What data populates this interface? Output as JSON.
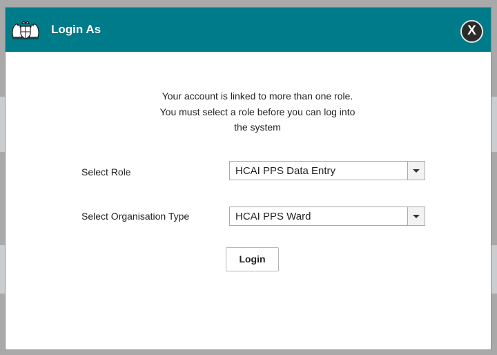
{
  "dialog": {
    "title": "Login As",
    "close_label": "X",
    "crest_icon": "royal-coat-of-arms-icon",
    "header_color": "#007b8a"
  },
  "message": {
    "line1": "Your account is linked to more than one role.",
    "line2": "You must select a role before you can log into",
    "line3": "the system"
  },
  "form": {
    "role_label": "Select Role",
    "role_value": "HCAI PPS Data Entry",
    "org_type_label": "Select Organisation Type",
    "org_type_value": "HCAI PPS Ward",
    "login_label": "Login"
  }
}
